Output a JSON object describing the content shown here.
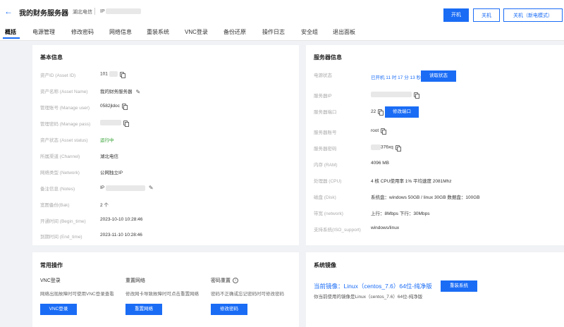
{
  "header": {
    "title": "我的财务服务器",
    "carrier": "湖北电信",
    "ip_label": "IP",
    "buttons": {
      "start": "开机",
      "shutdown": "关机",
      "shutdown_new": "关机（新电模式）"
    }
  },
  "tabs": [
    "概括",
    "电源管理",
    "修改密码",
    "网络信息",
    "重装系统",
    "VNC登录",
    "备份还原",
    "操作日志",
    "安全组",
    "退出面板"
  ],
  "basic_info": {
    "title": "基本信息",
    "rows": [
      {
        "label": "资产ID (Asset ID)",
        "value": "101"
      },
      {
        "label": "资产名称 (Asset Name)",
        "value": "我的财务服务器"
      },
      {
        "label": "管理账号 (Manage user)",
        "value": "0582jldoc"
      },
      {
        "label": "管理密码 (Manage pass)",
        "value": ""
      },
      {
        "label": "资产状态 (Asset status)",
        "value": "运行中"
      },
      {
        "label": "所属渠道 (Channel)",
        "value": "湖北电信"
      },
      {
        "label": "网络类型 (Network)",
        "value": "公网独立IP"
      },
      {
        "label": "备注信息 (Notes)",
        "value": "IP"
      },
      {
        "label": "宽图备份(Bak)",
        "value": "2 个"
      },
      {
        "label": "开通时间 (Begin_time)",
        "value": "2023-10-10 10:28:46"
      },
      {
        "label": "到期时间 (End_time)",
        "value": "2023-11-10 10:28:46"
      }
    ]
  },
  "server_info": {
    "title": "服务器信息",
    "rows": [
      {
        "label": "电源状态",
        "value": "已开机 11 时 17 分 13 秒",
        "button": "读取状态"
      },
      {
        "label": "服务器IP",
        "value": ""
      },
      {
        "label": "服务器端口",
        "value": "22",
        "button": "修改端口"
      },
      {
        "label": "服务器账号",
        "value": "root"
      },
      {
        "label": "服务器密码",
        "value": "376xq"
      },
      {
        "label": "内存 (RAM)",
        "value": "4096 MB"
      },
      {
        "label": "处理器 (CPU)",
        "value": "4 核 CPU使用率 1% 平均速度 2081Mhz"
      },
      {
        "label": "磁盘 (Disk)",
        "value": "系统盘：windows 50GB / linux 30GB 数据盘：100GB"
      },
      {
        "label": "带宽 (network)",
        "value": "上行：8Mbps 下行：30Mbps"
      },
      {
        "label": "支持系统(ISO_support)",
        "value": "windows/linux"
      }
    ]
  },
  "common_ops": {
    "title": "常用操作",
    "items": [
      {
        "title": "VNC登录",
        "desc": "网络出现故障时可使用VNC登录查看",
        "button": "VNC登录"
      },
      {
        "title": "重置网络",
        "desc": "修改网卡导致故障时可点击重置网络",
        "button": "重置网络"
      },
      {
        "title": "密码重置",
        "desc": "密码不正确或忘记密码时可修改密码",
        "button": "修改密码"
      }
    ]
  },
  "system_image": {
    "title": "系统镜像",
    "current": "当前镜像：Linux（centos_7.6）64位-纯净版",
    "desc": "你当前使用的镜像是Linux（centos_7.6）64位-纯净版",
    "button": "重装系统"
  },
  "colors": {
    "accent": "#1a6cf5",
    "status_running": "#2a9d2a"
  }
}
